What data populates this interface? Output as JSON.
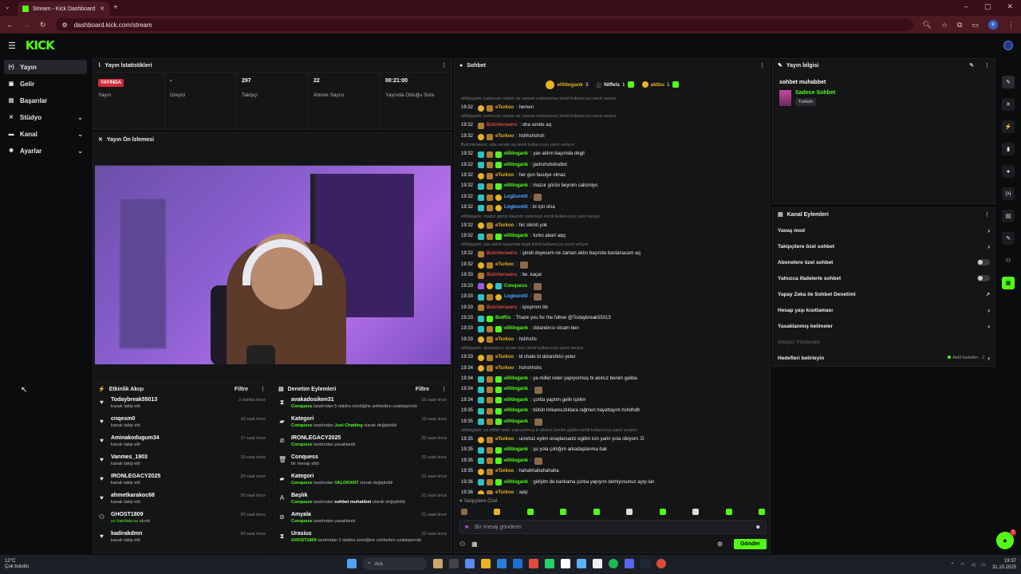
{
  "browser": {
    "tab_title": "Stream - Kick Dashboard",
    "url": "dashboard.kick.com/stream"
  },
  "brand": {
    "logo": "KICK",
    "accent": "#53fc18"
  },
  "sidebar": {
    "items": [
      {
        "label": "Yayın",
        "icon": "broadcast-icon",
        "active": true
      },
      {
        "label": "Gelir",
        "icon": "wallet-icon"
      },
      {
        "label": "Başarılar",
        "icon": "trophy-icon"
      },
      {
        "label": "Stüdyo",
        "icon": "studio-icon",
        "expandable": true
      },
      {
        "label": "Kanal",
        "icon": "channel-icon",
        "expandable": true
      },
      {
        "label": "Ayarlar",
        "icon": "gear-icon",
        "expandable": true
      }
    ]
  },
  "stats": {
    "title": "Yayın İstatistikleri",
    "items": [
      {
        "value": "YAYINDA",
        "label": "Yayın"
      },
      {
        "value": "-",
        "label": "İzleyici"
      },
      {
        "value": "297",
        "label": "Takipçi"
      },
      {
        "value": "22",
        "label": "Abone Sayısı"
      },
      {
        "value": "00:21:00",
        "label": "Yayında Olduğu Süre"
      }
    ]
  },
  "preview": {
    "title": "Yayın Ön İzlemesi"
  },
  "feed": {
    "title": "Etkinlik Akışı",
    "filter": "Filtre",
    "items": [
      {
        "name": "Todaybreak55013",
        "sub": "kanalı takip etti",
        "time": "3 dakika önce",
        "icon": "heart-icon"
      },
      {
        "name": "cnqesm0",
        "sub": "kanalı takip etti",
        "time": "10 saat önce",
        "icon": "heart-icon"
      },
      {
        "name": "Aminakodugum34",
        "sub": "kanalı takip etti",
        "time": "17 saat önce",
        "icon": "heart-icon"
      },
      {
        "name": "Vanmes_1903",
        "sub": "kanalı takip etti",
        "time": "19 saat önce",
        "icon": "heart-icon"
      },
      {
        "name": "IRONLEGACY2025",
        "sub": "kanalı takip etti",
        "time": "20 saat önce",
        "icon": "heart-icon"
      },
      {
        "name": "ahmetkarakoc68",
        "sub": "kanalı takip etti",
        "time": "20 saat önce",
        "icon": "heart-icon"
      },
      {
        "name": "GHOST1809",
        "sub_green": "su hatırlatıcısı",
        "sub": " alındı",
        "time": "20 saat önce",
        "icon": "gift-icon"
      },
      {
        "name": "kadirakdmn",
        "sub": "kanalı takip etti",
        "time": "20 saat önce",
        "icon": "heart-icon"
      }
    ]
  },
  "modactions": {
    "title": "Denetim Eylemleri",
    "filter": "Filtre",
    "items": [
      {
        "name": "avakadosiken31",
        "actor": "Conquess",
        "sub": " tarafından 5 dakika süreliğine sohbetten uzaklaştırıldı",
        "time": "16 saat önce",
        "icon": "hourglass-icon"
      },
      {
        "name": "Kategori",
        "actor": "Conquess",
        "sub": " tarafından ",
        "extra": "Just Chatting",
        "sub2": " olarak değiştirildi",
        "time": "19 saat önce",
        "icon": "folder-icon"
      },
      {
        "name": "IRONLEGACY2025",
        "actor": "Conquess",
        "sub": " tarafından yasaklandı",
        "time": "20 saat önce",
        "icon": "ban-icon"
      },
      {
        "name": "Conquess",
        "actor": "",
        "sub": "bir mesajı sildi",
        "time": "20 saat önce",
        "icon": "trash-icon"
      },
      {
        "name": "Kategori",
        "actor": "Conquess",
        "sub": " tarafından ",
        "extra": "VALORANT",
        "sub2": " olarak değiştirildi",
        "time": "21 saat önce",
        "icon": "folder-icon"
      },
      {
        "name": "Başlık",
        "actor": "Conquess",
        "sub": " tarafından ",
        "bold": "sohbet muhabbet",
        "sub2": " olarak değiştirildi",
        "time": "21 saat önce",
        "icon": "text-icon"
      },
      {
        "name": "Amyala",
        "actor": "Conquess",
        "sub": " tarafından yasaklandı",
        "time": "21 saat önce",
        "icon": "ban-icon"
      },
      {
        "name": "Urasius",
        "actor": "GHOST1809",
        "sub": " tarafından 2 dakika süreliğine sohbetten uzaklaştırıldı",
        "time": "22 saat önce",
        "icon": "hourglass-icon"
      }
    ]
  },
  "chat": {
    "title": "Sohbet",
    "pinned": [
      {
        "name": "elifdogank",
        "count": "3"
      },
      {
        "name": "Niffels",
        "count": "1"
      },
      {
        "name": "aktbu",
        "count": "1"
      }
    ],
    "messages": [
      {
        "reply": "elifdogank: turkocum selam ne zaman evleniyoruz isimli kullanıcıya yanıt veriyor"
      },
      {
        "time": "19:32",
        "user": "eTurkoo",
        "color": "#e8b321",
        "text": ": hemen"
      },
      {
        "reply": "elifdogank: turkocum selam ne zaman evleniyoruz isimli kullanıcıya yanıt veriyor"
      },
      {
        "time": "19:32",
        "user": "Butcherseers",
        "color": "#e0443c",
        "text": ": oha sende aq"
      },
      {
        "time": "19:32",
        "user": "eTurkoo",
        "color": "#e8b321",
        "text": ": hshhshshsh"
      },
      {
        "reply": "Butcherseers: oha sende aq isimli kullanıcıya yanıt veriyor"
      },
      {
        "time": "19:32",
        "user": "elifdogank",
        "color": "#53fc18",
        "text": ": yav aklım başımda degil"
      },
      {
        "time": "19:32",
        "user": "elifdogank",
        "color": "#53fc18",
        "text": ": jashshshsksdkd"
      },
      {
        "time": "19:32",
        "user": "eTurkoo",
        "color": "#e8b321",
        "text": ": her gun fasulye olmaz"
      },
      {
        "time": "19:32",
        "user": "elifdogank",
        "color": "#53fc18",
        "text": ": mazur görün beynim calismiyo"
      },
      {
        "time": "19:32",
        "user": "Logburetti",
        "color": "#4aa8ff",
        "text": ":",
        "emote": true
      },
      {
        "time": "19:32",
        "user": "Logburetti",
        "color": "#4aa8ff",
        "text": ": bi içki olsa"
      },
      {
        "reply": "elifdogank: mazur görün beynim calismiyo isimli kullanıcıya yanıt veriyor"
      },
      {
        "time": "19:32",
        "user": "eTurkoo",
        "color": "#e8b321",
        "text": ": hic sikinti yok"
      },
      {
        "time": "19:32",
        "user": "elifdogank",
        "color": "#53fc18",
        "text": ": turko abart aqq"
      },
      {
        "reply": "elifdogank: yav aklım başımda degil isimli kullanıcıya yanıt veriyor"
      },
      {
        "time": "19:32",
        "user": "Butcherseers",
        "color": "#e0443c",
        "text": ": şimdi doyecem ne zaman aklın başında banlanacam aq"
      },
      {
        "time": "19:32",
        "user": "eTurkoo",
        "color": "#e8b321",
        "text": ":",
        "emote": true
      },
      {
        "time": "19:33",
        "user": "Butcherseers",
        "color": "#e0443c",
        "text": ": be. kaçar"
      },
      {
        "time": "19:33",
        "user": "Conquess",
        "color": "#53fc18",
        "text": ":",
        "emote": true
      },
      {
        "time": "19:33",
        "user": "Logburetti",
        "color": "#4aa8ff",
        "text": ":",
        "emote": true
      },
      {
        "time": "19:33",
        "user": "Butcherseers",
        "color": "#e0443c",
        "text": ": işteyimm bb"
      },
      {
        "time": "19:33",
        "user": "BotRix",
        "color": "#53fc18",
        "text": ": Thank you for the follow @Todaybreak55013"
      },
      {
        "time": "19:33",
        "user": "elifdogank",
        "color": "#53fc18",
        "text": ": dolandırıcı olcam ben"
      },
      {
        "time": "19:33",
        "user": "eTurkoo",
        "color": "#e8b321",
        "text": ": hshhshs"
      },
      {
        "reply": "elifdogank: dolandırıcı olcam ben isimli kullanıcıya yanıt veriyor"
      },
      {
        "time": "19:33",
        "user": "eTurkoo",
        "color": "#e8b321",
        "text": ": bi chate bi dolandirici yeter"
      },
      {
        "time": "19:34",
        "user": "eTurkoo",
        "color": "#e8b321",
        "text": ": hshshhshs"
      },
      {
        "time": "19:34",
        "user": "elifdogank",
        "color": "#53fc18",
        "text": ": ya millet neler yapıyormuş bi akılsız benim galiba"
      },
      {
        "time": "19:34",
        "user": "elifdogank",
        "color": "#53fc18",
        "text": ":",
        "emote": true
      },
      {
        "time": "19:34",
        "user": "elifdogank",
        "color": "#53fc18",
        "text": ": çorba yaptım gelin içelim"
      },
      {
        "time": "19:35",
        "user": "elifdogank",
        "color": "#53fc18",
        "text": ": bütün imkansızlıklara rağmen hayattayım hshdhdh"
      },
      {
        "time": "19:35",
        "user": "elifdogank",
        "color": "#53fc18",
        "text": ":",
        "emote": true
      },
      {
        "reply": "elifdogank: ya millet neler yapıyormuş bi akılsız benim galiba isimli kullanıcıya yanıt veriyor"
      },
      {
        "time": "19:35",
        "user": "eTurkoo",
        "color": "#e8b321",
        "text": ": ucretsiz eytim onaylarsaniz egitim icin yarin yola cikiyom :D"
      },
      {
        "time": "19:35",
        "user": "elifdogank",
        "color": "#53fc18",
        "text": ": şu yola çıktığım arkadaşlarıma bak"
      },
      {
        "time": "19:35",
        "user": "elifdogank",
        "color": "#53fc18",
        "text": ":",
        "emote": true
      },
      {
        "time": "19:35",
        "user": "eTurkoo",
        "color": "#e8b321",
        "text": ": hahahhahahahaha"
      },
      {
        "time": "19:36",
        "user": "elifdogank",
        "color": "#53fc18",
        "text": ": gidiyim de kankama çorba yapıyım demiyosunuz ayıp lan"
      },
      {
        "time": "19:36",
        "user": "eTurkoo",
        "color": "#e8b321",
        "text": ": ayip"
      }
    ],
    "followers_only": "Takipçilere Özel",
    "input_placeholder": "Bir mesaj gönderin",
    "send_label": "Gönder"
  },
  "info": {
    "title": "Yayın bilgisi",
    "stream_title": "sohbet muhabbet",
    "category": "Sadece Sohbet",
    "tag": "Turkish"
  },
  "channel_actions": {
    "title": "Kanal Eylemleri",
    "items": [
      {
        "label": "Yavaş mod",
        "type": "arrow"
      },
      {
        "label": "Takipçilere özel sohbet",
        "type": "arrow"
      },
      {
        "label": "Abonelere özel sohbet",
        "type": "toggle"
      },
      {
        "label": "Yalnızca ifadelerle sohbet",
        "type": "toggle"
      },
      {
        "label": "Yapay Zeka ile Sohbet Denetimi",
        "type": "external"
      },
      {
        "label": "Hesap yaşı kısıtlaması",
        "type": "arrow"
      },
      {
        "label": "Yasaklanmış kelimeler",
        "type": "arrow"
      },
      {
        "label": "İzleyici Yönlendir",
        "type": "disabled"
      },
      {
        "label": "Hedefleri belirleyin",
        "type": "goals",
        "goals": "Aktif hedefler - 2"
      }
    ]
  },
  "help_badge": "2",
  "taskbar": {
    "temp": "12°C",
    "weather": "Çok bulutlu",
    "search": "Ara",
    "time": "19:37",
    "date": "31.10.2025"
  }
}
